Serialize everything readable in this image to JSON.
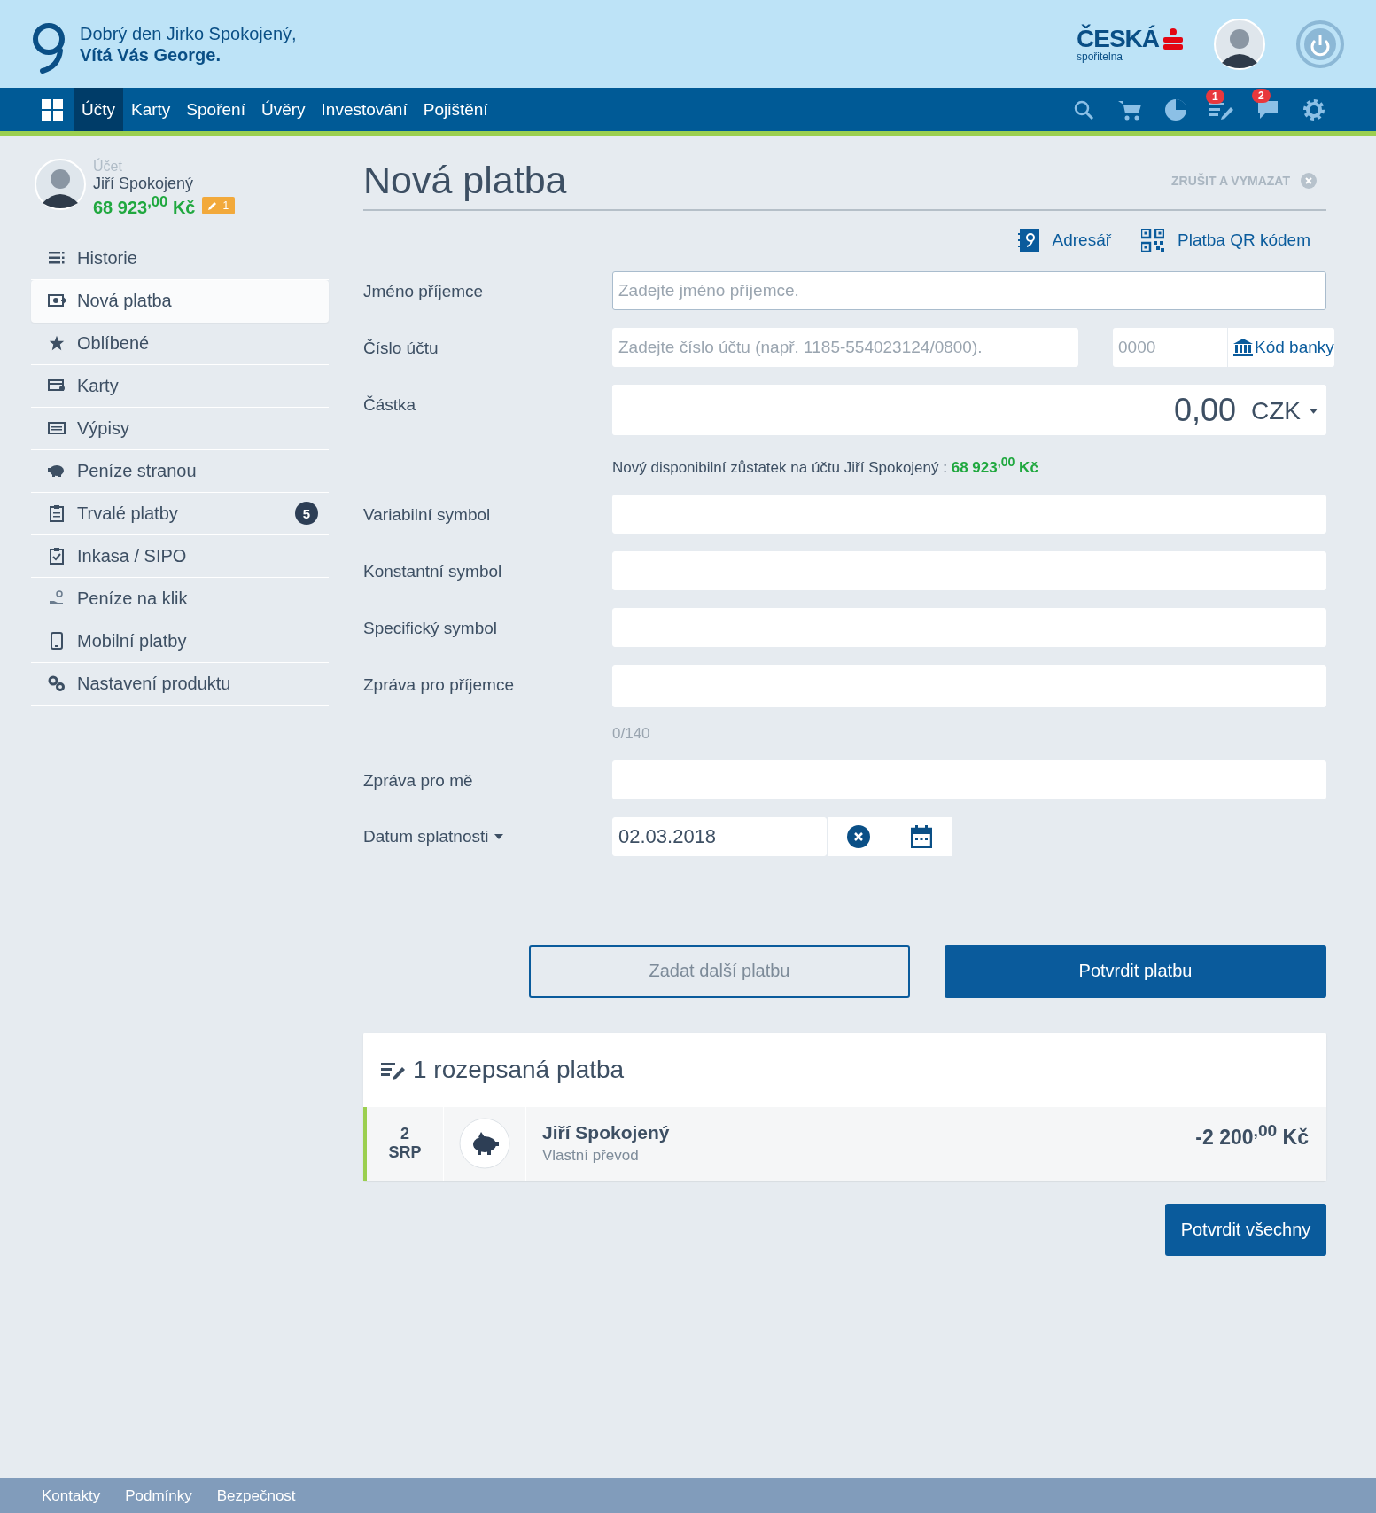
{
  "header": {
    "greeting": "Dobrý den Jirko Spokojený,",
    "welcome": "Vítá Vás George.",
    "bank_name": "ČESKÁ",
    "bank_sub": "spořitelna"
  },
  "nav": {
    "items": [
      {
        "label": "Účty",
        "selected": true
      },
      {
        "label": "Karty",
        "selected": false
      },
      {
        "label": "Spoření",
        "selected": false
      },
      {
        "label": "Úvěry",
        "selected": false
      },
      {
        "label": "Investování",
        "selected": false
      },
      {
        "label": "Pojištění",
        "selected": false
      }
    ],
    "icons": [
      {
        "kind": "search"
      },
      {
        "kind": "cart"
      },
      {
        "kind": "chart"
      },
      {
        "kind": "drafts",
        "badge": "1"
      },
      {
        "kind": "messages",
        "badge": "2"
      },
      {
        "kind": "settings"
      }
    ]
  },
  "account": {
    "label": "Účet",
    "name": "Jiří Spokojený",
    "balance": "68 923$^{,00}$ Kč",
    "draft_badge": "1"
  },
  "sidebar": {
    "items": [
      {
        "label": "Historie",
        "kind": "list",
        "selected": false
      },
      {
        "label": "Nová platba",
        "kind": "payment",
        "selected": true
      },
      {
        "label": "Oblíbené",
        "kind": "star",
        "selected": false
      },
      {
        "label": "Karty",
        "kind": "card",
        "selected": false
      },
      {
        "label": "Výpisy",
        "kind": "statement",
        "selected": false
      },
      {
        "label": "Peníze stranou",
        "kind": "piggy",
        "selected": false
      },
      {
        "label": "Trvalé platby",
        "kind": "clipboard",
        "selected": false,
        "badge": "5"
      },
      {
        "label": "Inkasa / SIPO",
        "kind": "checklist",
        "selected": false
      },
      {
        "label": "Peníze na klik",
        "kind": "hand",
        "selected": false
      },
      {
        "label": "Mobilní platby",
        "kind": "phone",
        "selected": false
      },
      {
        "label": "Nastavení produktu",
        "kind": "gears",
        "selected": false
      }
    ]
  },
  "page": {
    "title": "Nová platba",
    "cancel": "ZRUŠIT A VYMAZAT",
    "links": [
      {
        "kind": "addressbook",
        "label": "Adresář"
      },
      {
        "kind": "qr",
        "label": "Platba QR kódem"
      }
    ]
  },
  "form": {
    "fields": [
      {
        "label": "Jméno příjemce",
        "kind": "text",
        "placeholder": "Zadejte jméno příjemce.",
        "focused": true
      },
      {
        "label": "Číslo účtu",
        "kind": "account",
        "placeholder": "Zadejte číslo účtu (např. 1185-554023124/0800).",
        "bank_placeholder": "0000",
        "bank_button": "Kód banky"
      },
      {
        "label": "Částka",
        "kind": "amount",
        "value": "0,00",
        "currency": "CZK",
        "hint": "Nový disponibilní zůstatek na účtu Jiří Spokojený : **68 923$^{,00}$ Kč**"
      },
      {
        "label": "Variabilní symbol",
        "kind": "text"
      },
      {
        "label": "Konstantní symbol",
        "kind": "text"
      },
      {
        "label": "Specifický symbol",
        "kind": "text"
      },
      {
        "label": "Zpráva pro příjemce",
        "kind": "message",
        "counter": "0/140"
      },
      {
        "label": "Zpráva pro mě",
        "kind": "text"
      },
      {
        "label": "Datum splatnosti",
        "kind": "date",
        "value": "02.03.2018"
      }
    ]
  },
  "actions": [
    {
      "label": "Zadat další platbu",
      "kind": "secondary"
    },
    {
      "label": "Potvrdit platbu",
      "kind": "primary"
    }
  ],
  "drafts": {
    "title": "1 rozepsaná platba",
    "items": [
      {
        "count": "2",
        "code": "SRP",
        "name": "Jiří Spokojený",
        "type": "Vlastní převod",
        "amount": "-2 200$^{,00}$ Kč"
      }
    ],
    "confirm_all": "Potvrdit všechny"
  },
  "footer": {
    "links": [
      "Kontakty",
      "Podmínky",
      "Bezpečnost"
    ]
  }
}
